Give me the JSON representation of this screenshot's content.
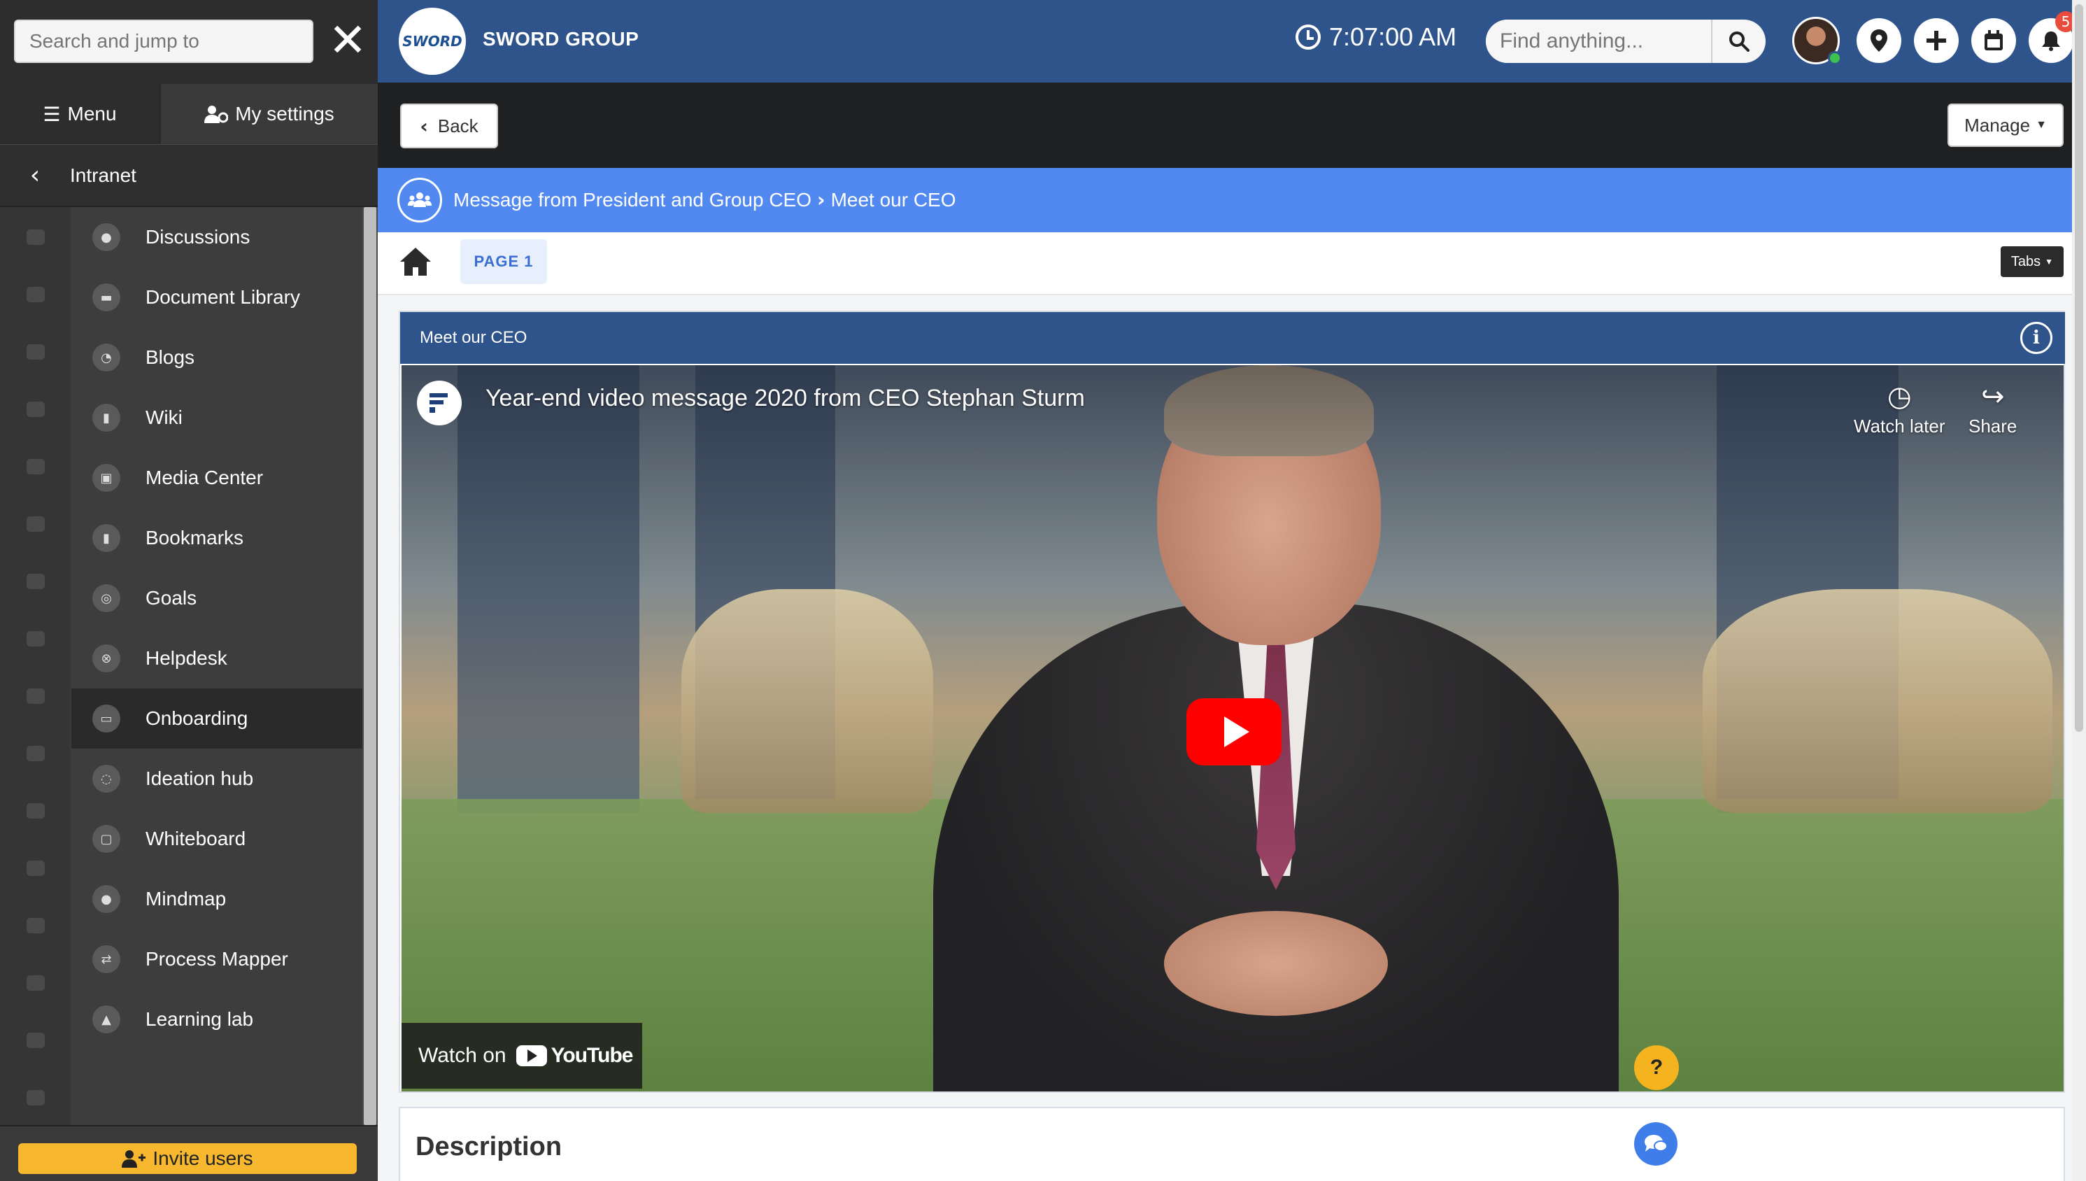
{
  "sidebar": {
    "search_placeholder": "Search and jump to",
    "tabs": {
      "menu": "Menu",
      "settings": "My settings"
    },
    "breadcrumb": "Intranet",
    "items": [
      {
        "label": "Discussions",
        "icon": "chat-icon"
      },
      {
        "label": "Document Library",
        "icon": "folder-icon"
      },
      {
        "label": "Blogs",
        "icon": "rss-icon"
      },
      {
        "label": "Wiki",
        "icon": "book-icon"
      },
      {
        "label": "Media Center",
        "icon": "images-icon"
      },
      {
        "label": "Bookmarks",
        "icon": "bookmark-icon"
      },
      {
        "label": "Goals",
        "icon": "target-icon"
      },
      {
        "label": "Helpdesk",
        "icon": "lifering-icon"
      },
      {
        "label": "Onboarding",
        "icon": "chalkboard-icon"
      },
      {
        "label": "Ideation hub",
        "icon": "lightbulb-icon"
      },
      {
        "label": "Whiteboard",
        "icon": "whiteboard-icon"
      },
      {
        "label": "Mindmap",
        "icon": "brain-icon"
      },
      {
        "label": "Process Mapper",
        "icon": "exchange-icon"
      },
      {
        "label": "Learning lab",
        "icon": "graduation-cap-icon"
      }
    ],
    "active_item": "Onboarding",
    "invite_label": "Invite users"
  },
  "topbar": {
    "brand_logo_text": "SWORD",
    "brand_name": "SWORD GROUP",
    "time": "7:07:00 AM",
    "find_placeholder": "Find anything...",
    "notification_count": "5"
  },
  "toolbar": {
    "back_label": "Back",
    "manage_label": "Manage"
  },
  "breadcrumb": {
    "parent": "Message from President and Group CEO",
    "current": "Meet our CEO"
  },
  "tabs": {
    "page_tab": "PAGE 1",
    "tabs_button": "Tabs"
  },
  "widget": {
    "title": "Meet our CEO",
    "video": {
      "title": "Year-end video message 2020 from CEO Stephan Sturm",
      "watch_later": "Watch later",
      "share": "Share",
      "watch_on": "Watch on",
      "youtube": "YouTube"
    }
  },
  "description": {
    "heading": "Description"
  },
  "colors": {
    "topbar": "#2f548b",
    "breadcrumb_bar": "#5189f0",
    "sidebar": "#3a3a3a",
    "invite_button": "#f7b82f",
    "youtube_red": "#ff0000"
  }
}
